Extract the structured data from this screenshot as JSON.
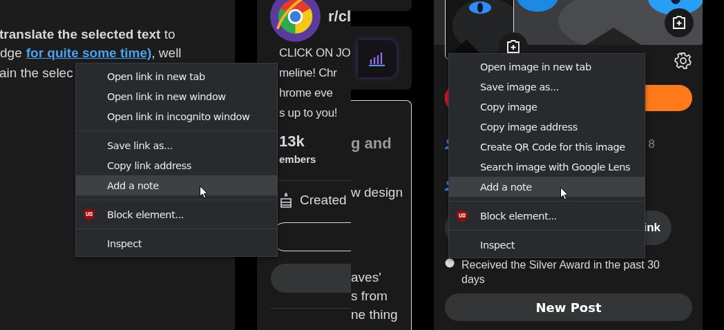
{
  "article": {
    "line_1": "**translate the selected text** to",
    "line_2_start": "dge",
    "link": "for quite some time)",
    "line_2_end": ", well",
    "line_3": "ain the selec"
  },
  "subreddit": {
    "name": "r/cl",
    "description": [
      "CLICK ON JO",
      "meline! Chr",
      "hrome eve",
      "s up to you!"
    ],
    "members_count": "13k",
    "members_label": "embers",
    "created": "Created"
  },
  "background_card": {
    "lines": [
      "g and",
      "w design",
      "aves'",
      "s from",
      "ne thing"
    ]
  },
  "profile": {
    "stat": "8",
    "pill_button": "ink",
    "award": "Received the Silver Award in the past 30 days",
    "new_post_button": "New Post"
  },
  "link_menu": {
    "groups": [
      [
        {
          "label": "Open link in new tab",
          "kind": "plain",
          "hovered": false
        },
        {
          "label": "Open link in new window",
          "kind": "plain",
          "hovered": false
        },
        {
          "label": "Open link in incognito window",
          "kind": "plain",
          "hovered": false
        }
      ],
      [
        {
          "label": "Save link as...",
          "kind": "plain",
          "hovered": false
        },
        {
          "label": "Copy link address",
          "kind": "plain",
          "hovered": false
        },
        {
          "label": "Add a note",
          "kind": "plain",
          "hovered": true
        }
      ],
      [
        {
          "label": "Block element...",
          "kind": "extension",
          "hovered": false
        }
      ],
      [
        {
          "label": "Inspect",
          "kind": "plain",
          "hovered": false
        }
      ]
    ]
  },
  "image_menu": {
    "groups": [
      [
        {
          "label": "Open image in new tab",
          "kind": "plain",
          "hovered": false
        },
        {
          "label": "Save image as...",
          "kind": "plain",
          "hovered": false
        },
        {
          "label": "Copy image",
          "kind": "plain",
          "hovered": false
        },
        {
          "label": "Copy image address",
          "kind": "plain",
          "hovered": false
        },
        {
          "label": "Create QR Code for this image",
          "kind": "plain",
          "hovered": false
        },
        {
          "label": "Search image with Google Lens",
          "kind": "plain",
          "hovered": false
        },
        {
          "label": "Add a note",
          "kind": "plain",
          "hovered": true
        }
      ],
      [
        {
          "label": "Block element...",
          "kind": "extension",
          "hovered": false
        }
      ],
      [
        {
          "label": "Inspect",
          "kind": "plain",
          "hovered": false
        }
      ]
    ]
  }
}
